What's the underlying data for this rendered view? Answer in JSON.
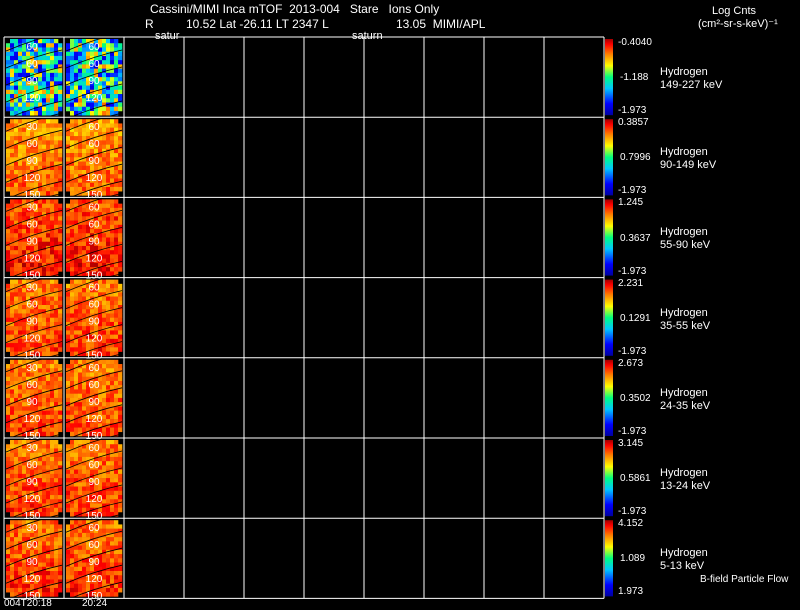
{
  "header": {
    "title": "Cassini/MIMI Inca mTOF  2013-004   Stare   Ions Only",
    "line2_R": "R",
    "line2_mid": "10.52 Lat -26.11 LT 2347 L",
    "line2_right": "13.05  MIMI/APL",
    "satur_left": "satur",
    "satur_right": "saturn",
    "units_line1": "Log Cnts",
    "units_line2": "(cm²-sr-s-keV)⁻¹"
  },
  "footer": {
    "time_1": "004T20:18",
    "time_2": "20:24",
    "legend": "B-field Particle Flow"
  },
  "chart_data": {
    "type": "heatmap",
    "title": "Cassini/MIMI Inca mTOF  2013-004   Stare   Ions Only",
    "x_ticks": [
      "004T20:18",
      "20:24"
    ],
    "contour_labels": [
      "30",
      "60",
      "90",
      "120",
      "150"
    ],
    "colorbar_colors": [
      "#0000a0",
      "#0000ff",
      "#00c8ff",
      "#00ff80",
      "#ffff00",
      "#ff8000",
      "#ff0000",
      "#a00000"
    ],
    "panels": [
      {
        "species": "Hydrogen",
        "energy": "149-227 keV",
        "cb_max": "-0.4040",
        "cb_mid": "-1.188",
        "cb_min": "-1.973",
        "mean_level": 0.45
      },
      {
        "species": "Hydrogen",
        "energy": "90-149 keV",
        "cb_max": "0.3857",
        "cb_mid": "0.7996",
        "cb_min": "-1.973",
        "mean_level": 0.8
      },
      {
        "species": "Hydrogen",
        "energy": "55-90 keV",
        "cb_max": "1.245",
        "cb_mid": "0.3637",
        "cb_min": "-1.973",
        "mean_level": 0.88
      },
      {
        "species": "Hydrogen",
        "energy": "35-55 keV",
        "cb_max": "2.231",
        "cb_mid": "0.1291",
        "cb_min": "-1.973",
        "mean_level": 0.84
      },
      {
        "species": "Hydrogen",
        "energy": "24-35 keV",
        "cb_max": "2.673",
        "cb_mid": "0.3502",
        "cb_min": "-1.973",
        "mean_level": 0.83
      },
      {
        "species": "Hydrogen",
        "energy": "13-24 keV",
        "cb_max": "3.145",
        "cb_mid": "0.5861",
        "cb_min": "-1.973",
        "mean_level": 0.84
      },
      {
        "species": "Hydrogen",
        "energy": "5-13 keV",
        "cb_max": "4.152",
        "cb_mid": "1.089",
        "cb_min": "1.973",
        "mean_level": 0.85
      }
    ]
  }
}
